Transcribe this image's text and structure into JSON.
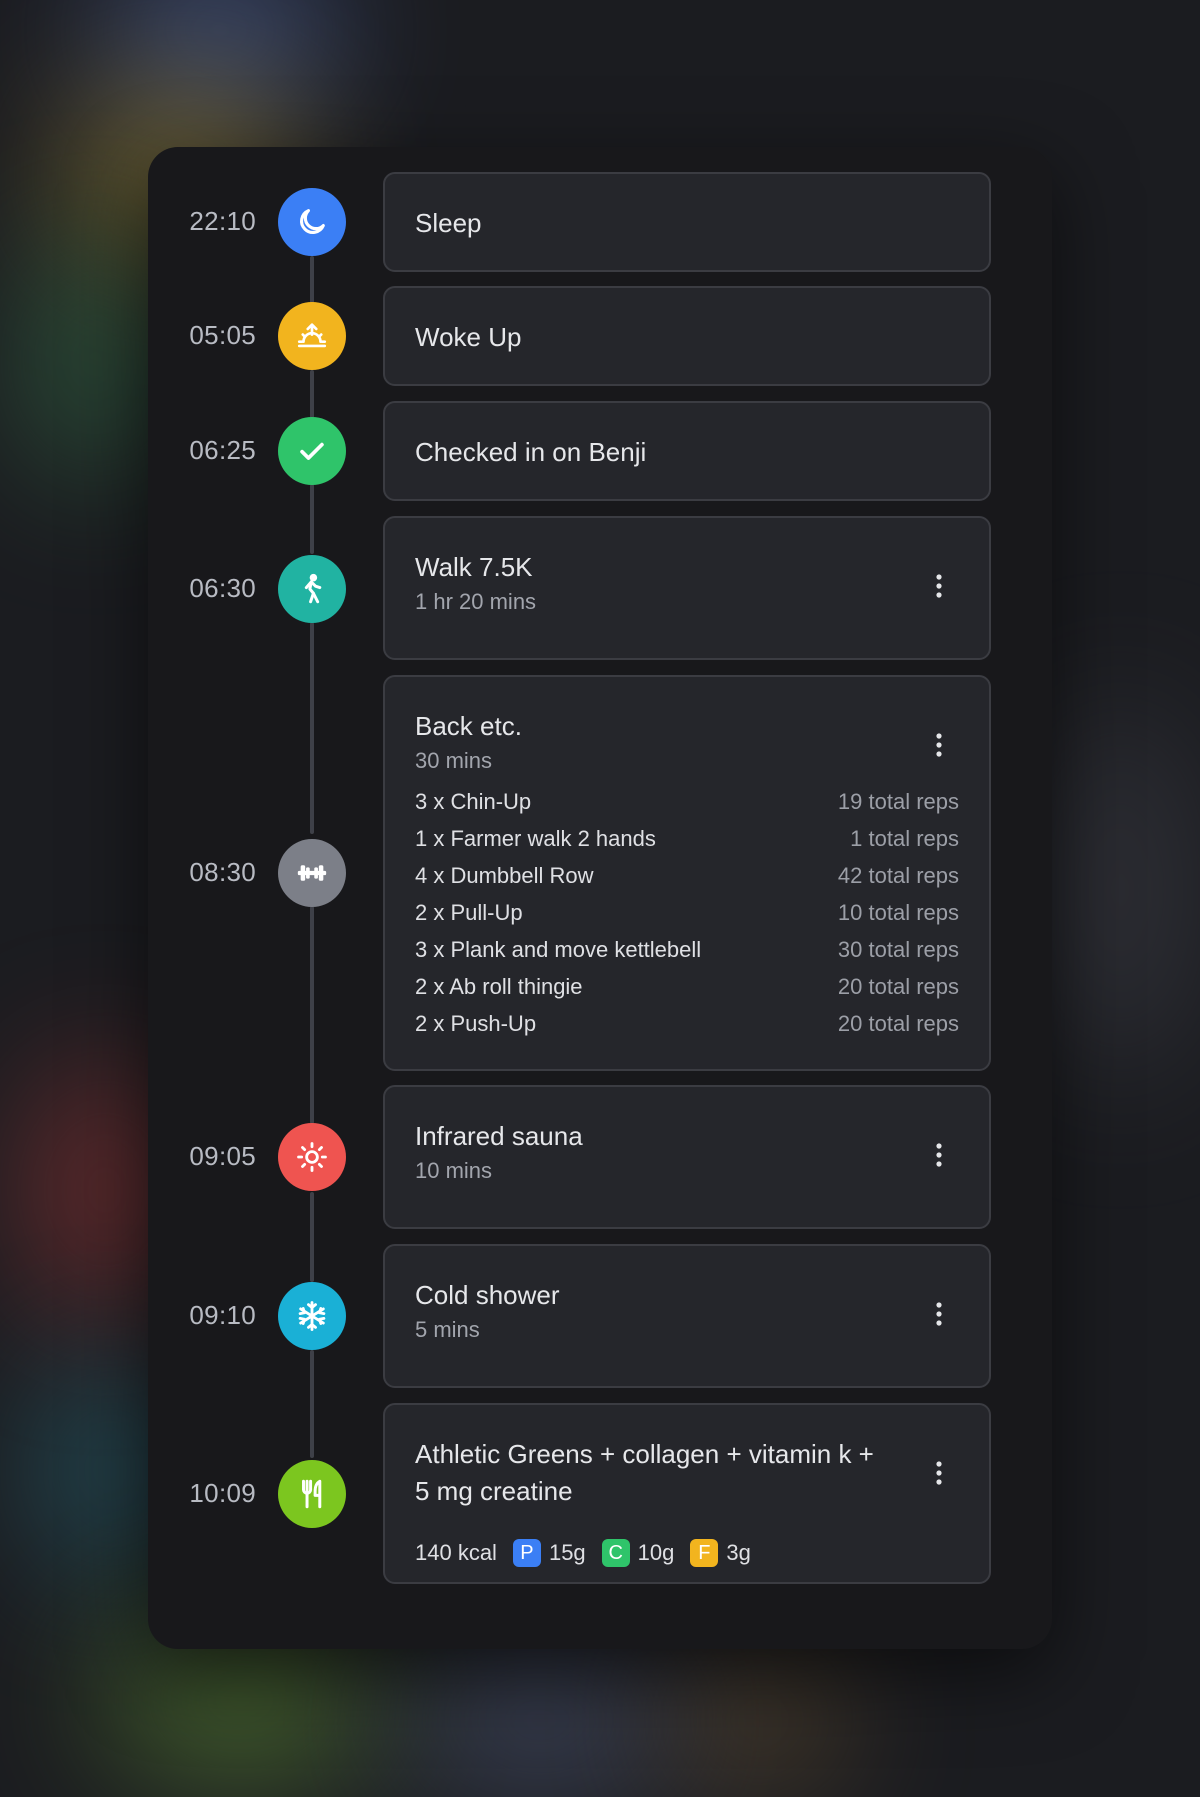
{
  "timeline": [
    {
      "time": "22:10",
      "icon": "moon-icon",
      "color": "#3b7ff5",
      "title": "Sleep"
    },
    {
      "time": "05:05",
      "icon": "sunrise-icon",
      "color": "#f2b41e",
      "title": "Woke Up"
    },
    {
      "time": "06:25",
      "icon": "checkmark-icon",
      "color": "#2fc46a",
      "title": "Checked in on Benji"
    },
    {
      "time": "06:30",
      "icon": "walking-icon",
      "color": "#21b3a2",
      "title": "Walk 7.5K",
      "subtitle": "1 hr 20 mins"
    },
    {
      "time": "08:30",
      "icon": "dumbbell-icon",
      "color": "#7c7f88",
      "title": "Back etc.",
      "subtitle": "30 mins",
      "exercises": [
        {
          "name": "3 x Chin-Up",
          "reps": "19 total reps"
        },
        {
          "name": "1 x Farmer walk 2 hands",
          "reps": "1 total reps"
        },
        {
          "name": "4 x Dumbbell Row",
          "reps": "42 total reps"
        },
        {
          "name": "2 x Pull-Up",
          "reps": "10 total reps"
        },
        {
          "name": "3 x Plank and move kettlebell",
          "reps": "30 total reps"
        },
        {
          "name": "2 x Ab roll thingie",
          "reps": "20 total reps"
        },
        {
          "name": "2 x Push-Up",
          "reps": "20 total reps"
        }
      ]
    },
    {
      "time": "09:05",
      "icon": "sun-icon",
      "color": "#ef5450",
      "title": "Infrared sauna",
      "subtitle": "10 mins"
    },
    {
      "time": "09:10",
      "icon": "snowflake-icon",
      "color": "#1ab0d6",
      "title": "Cold shower",
      "subtitle": "5 mins"
    },
    {
      "time": "10:09",
      "icon": "fork-knife-icon",
      "color": "#7cc61f",
      "title_line1": "Athletic Greens + collagen + vitamin k +",
      "title_line2": "5 mg creatine",
      "kcal": "140 kcal",
      "macros": [
        {
          "letter": "P",
          "value": "15g",
          "color": "#3b7ff5"
        },
        {
          "letter": "C",
          "value": "10g",
          "color": "#2fc46a"
        },
        {
          "letter": "F",
          "value": "3g",
          "color": "#f2b41e"
        }
      ]
    }
  ]
}
